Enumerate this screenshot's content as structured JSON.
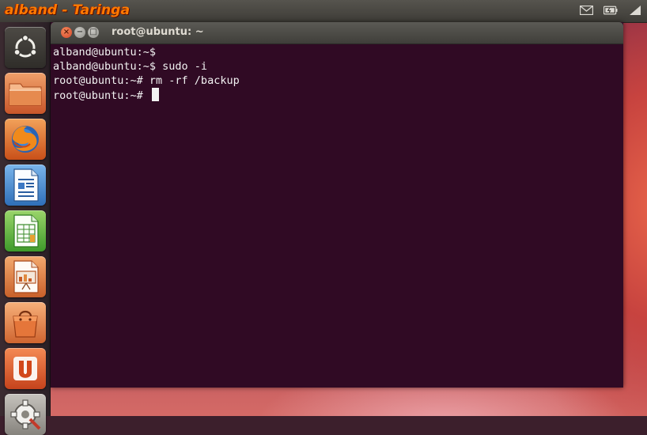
{
  "top_panel": {
    "brand": "alband - Taringa",
    "indicators": [
      "mail-icon",
      "battery-icon",
      "network-icon"
    ]
  },
  "launcher": {
    "items": [
      {
        "name": "dash-button",
        "icon": "ubuntu-logo-icon"
      },
      {
        "name": "files-launcher",
        "icon": "folder-icon"
      },
      {
        "name": "firefox-launcher",
        "icon": "firefox-icon"
      },
      {
        "name": "writer-launcher",
        "icon": "libreoffice-writer-icon"
      },
      {
        "name": "calc-launcher",
        "icon": "libreoffice-calc-icon"
      },
      {
        "name": "impress-launcher",
        "icon": "libreoffice-impress-icon"
      },
      {
        "name": "software-center-launcher",
        "icon": "shopping-bag-icon"
      },
      {
        "name": "ubuntu-one-launcher",
        "icon": "ubuntu-one-icon"
      },
      {
        "name": "system-settings-launcher",
        "icon": "gear-icon"
      }
    ]
  },
  "window": {
    "title": "root@ubuntu: ~",
    "close_glyph": "×",
    "min_glyph": "−",
    "max_glyph": "□"
  },
  "terminal": {
    "lines": [
      "alband@ubuntu:~$",
      "alband@ubuntu:~$ sudo -i",
      "root@ubuntu:~# rm -rf /backup",
      "root@ubuntu:~# "
    ]
  },
  "colors": {
    "terminal_bg": "#300a24",
    "terminal_fg": "#f2f2f2",
    "brand": "#ff7a00"
  }
}
